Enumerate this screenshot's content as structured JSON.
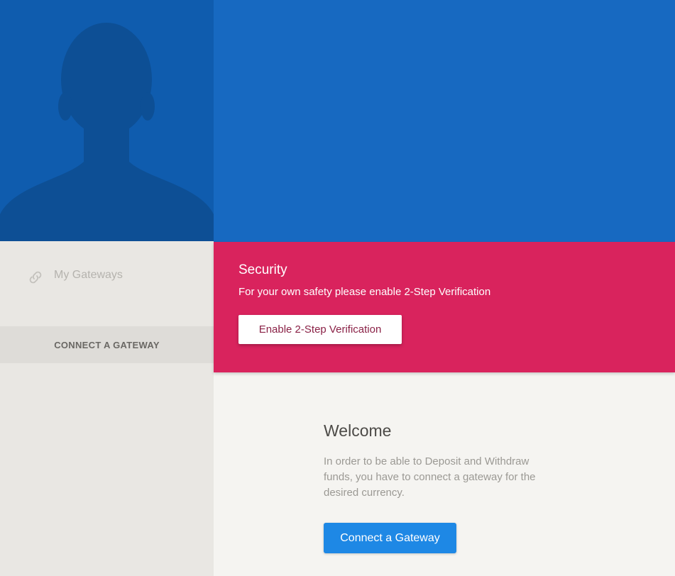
{
  "colors": {
    "sidebar_bg": "#e9e7e3",
    "avatar_bg": "#0f5cae",
    "avatar_silhouette": "#0d4f95",
    "header_bg": "#1769c1",
    "security_bg": "#d9235d",
    "primary_button": "#1e88e5"
  },
  "sidebar": {
    "avatar_icon": "user-silhouette-icon",
    "nav": {
      "gateways_icon": "link-icon",
      "gateways_label": "My Gateways"
    },
    "connect_label": "CONNECT A GATEWAY"
  },
  "security": {
    "title": "Security",
    "message": "For your own safety please enable 2-Step Verification",
    "button_label": "Enable 2-Step Verification"
  },
  "welcome": {
    "heading": "Welcome",
    "description": "In order to be able to Deposit and Withdraw funds, you have to connect a gateway for the desired currency.",
    "button_label": "Connect a Gateway"
  }
}
